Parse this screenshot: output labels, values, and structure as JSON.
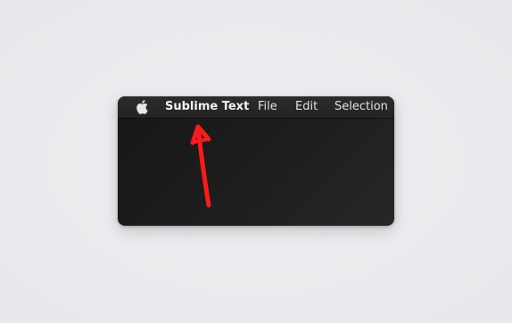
{
  "menubar": {
    "apple_icon": "apple-logo-icon",
    "app_name": "Sublime Text",
    "items": [
      "File",
      "Edit",
      "Selection"
    ]
  },
  "annotation": {
    "icon": "red-arrow-icon",
    "color": "#ff1a1a"
  },
  "colors": {
    "window_bg": "#1c1c1c",
    "menubar_bg": "#2a2a2a",
    "menu_text": "#e2e2e2",
    "page_bg": "#e9ebee"
  }
}
